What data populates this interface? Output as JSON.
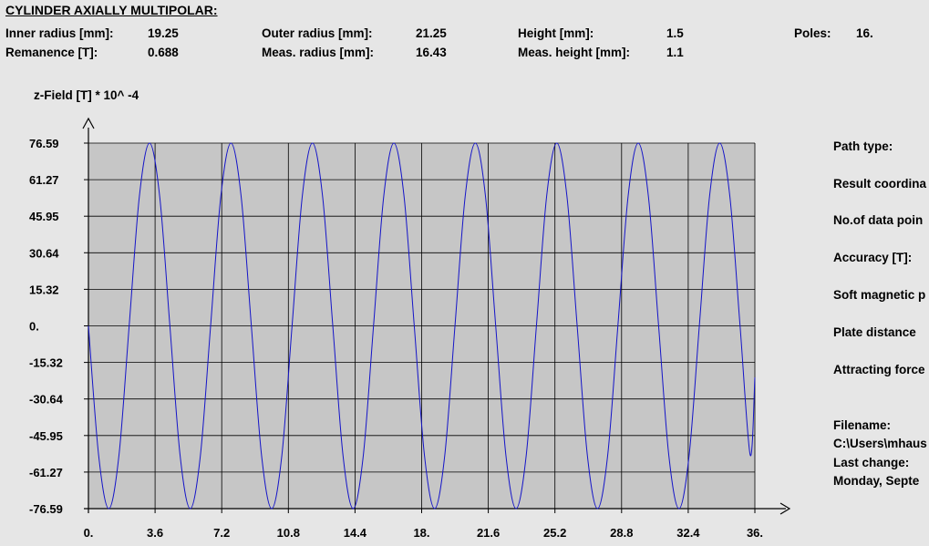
{
  "header": {
    "title": "CYLINDER AXIALLY MULTIPOLAR:",
    "params": [
      {
        "label": "Inner radius [mm]:",
        "value": "19.25"
      },
      {
        "label": "Remanence [T]:",
        "value": "0.688"
      },
      {
        "label": "Outer radius [mm]:",
        "value": "21.25"
      },
      {
        "label": "Meas. radius [mm]:",
        "value": "16.43"
      },
      {
        "label": "Height [mm]:",
        "value": "1.5"
      },
      {
        "label": "Meas. height [mm]:",
        "value": "1.1"
      },
      {
        "label": "Poles:",
        "value": "16."
      }
    ]
  },
  "side_panel": {
    "path_type": "Path type:",
    "result_coordinates": "Result coordina",
    "data_points": "No.of data poin",
    "accuracy": "Accuracy [T]:",
    "soft_magnetic": "Soft magnetic p",
    "plate_distance": "Plate distance",
    "attracting_force": "Attracting force",
    "filename_label": "Filename:",
    "filename_value": "C:\\Users\\mhaus",
    "last_change_label": "Last change:",
    "last_change_value": "Monday, Septe"
  },
  "chart_data": {
    "type": "line",
    "ylabel": "z-Field [T] * 10^ -4",
    "xlabel": "",
    "xlim": [
      0,
      36
    ],
    "ylim": [
      -76.59,
      76.59
    ],
    "x_ticks": [
      "0.",
      "3.6",
      "7.2",
      "10.8",
      "14.4",
      "18.",
      "21.6",
      "25.2",
      "28.8",
      "32.4",
      "36."
    ],
    "y_ticks": [
      "76.59",
      "61.27",
      "45.95",
      "30.64",
      "15.32",
      "0.",
      "-15.32",
      "-30.64",
      "-45.95",
      "-61.27",
      "-76.59"
    ],
    "grid": true,
    "series": [
      {
        "color": "#1414c8",
        "x": [
          0,
          0.55,
          1.1,
          1.65,
          2.2,
          2.75,
          3.3,
          3.85,
          4.4,
          4.95,
          5.5,
          6.05,
          6.6,
          7.15,
          7.7,
          8.25,
          8.8,
          9.35,
          9.9,
          10.45,
          11.0,
          11.55,
          12.1,
          12.65,
          13.2,
          13.75,
          14.3,
          14.85,
          15.4,
          15.95,
          16.5,
          17.05,
          17.6,
          18.15,
          18.7,
          19.25,
          19.8,
          20.35,
          20.9,
          21.45,
          22.0,
          22.55,
          23.1,
          23.65,
          24.2,
          24.75,
          25.3,
          25.85,
          26.4,
          26.95,
          27.5,
          28.05,
          28.6,
          29.15,
          29.7,
          30.25,
          30.8,
          31.35,
          31.9,
          32.45,
          33.0,
          33.55,
          34.1,
          34.65,
          35.2,
          35.75,
          36.0
        ],
        "values": [
          0.0,
          -54.16,
          -76.59,
          -54.16,
          0.0,
          54.16,
          76.59,
          54.16,
          0.0,
          -54.16,
          -76.59,
          -54.16,
          0.0,
          54.16,
          76.59,
          54.16,
          0.0,
          -54.16,
          -76.59,
          -54.16,
          0.0,
          54.16,
          76.59,
          54.16,
          0.0,
          -54.16,
          -76.59,
          -54.16,
          0.0,
          54.16,
          76.59,
          54.16,
          0.0,
          -54.16,
          -76.59,
          -54.16,
          0.0,
          54.16,
          76.59,
          54.16,
          0.0,
          -54.16,
          -76.59,
          -54.16,
          0.0,
          54.16,
          76.59,
          54.16,
          0.0,
          -54.16,
          -76.59,
          -54.16,
          0.0,
          54.16,
          76.59,
          54.16,
          0.0,
          -54.16,
          -76.59,
          -54.16,
          0.0,
          54.16,
          76.59,
          54.16,
          0.0,
          -54.16,
          -21.6
        ]
      }
    ]
  }
}
